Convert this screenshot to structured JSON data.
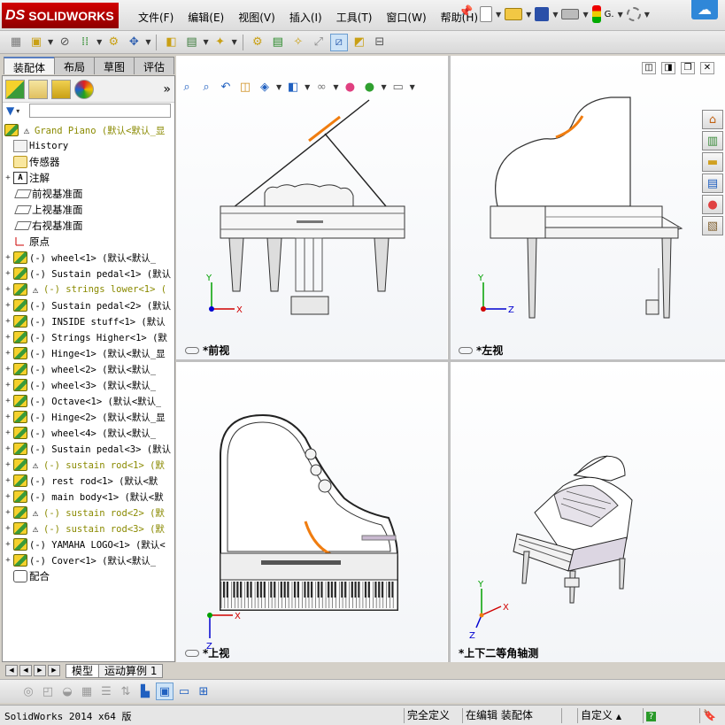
{
  "app": {
    "logo_ds": "DS",
    "logo_text": "SOLIDWORKS",
    "menu": [
      "文件(F)",
      "编辑(E)",
      "视图(V)",
      "插入(I)",
      "工具(T)",
      "窗口(W)",
      "帮助(H)"
    ],
    "menu_overflow": "G."
  },
  "left_tabs": [
    "装配体",
    "布局",
    "草图",
    "评估"
  ],
  "active_left_tab": "装配体",
  "tree": {
    "root": "Grand Piano  (默认<默认_显",
    "items": [
      {
        "label": "History",
        "icon": "history-icon",
        "expand": ""
      },
      {
        "label": "传感器",
        "icon": "sensor-icon",
        "expand": ""
      },
      {
        "label": "注解",
        "icon": "annotation-icon",
        "expand": "+"
      },
      {
        "label": "前视基准面",
        "icon": "plane-icon",
        "expand": ""
      },
      {
        "label": "上视基准面",
        "icon": "plane-icon",
        "expand": ""
      },
      {
        "label": "右视基准面",
        "icon": "plane-icon",
        "expand": ""
      },
      {
        "label": "原点",
        "icon": "origin-icon",
        "expand": ""
      },
      {
        "label": "(-) wheel<1> (默认<默认_",
        "icon": "part-icon",
        "expand": "+",
        "warning": false
      },
      {
        "label": "(-) Sustain pedal<1> (默认",
        "icon": "part-icon",
        "expand": "+",
        "warning": false
      },
      {
        "label": "(-) strings lower<1> (",
        "icon": "part-icon",
        "expand": "+",
        "warning": true
      },
      {
        "label": "(-) Sustain pedal<2> (默认",
        "icon": "part-icon",
        "expand": "+",
        "warning": false
      },
      {
        "label": "(-) INSIDE stuff<1> (默认",
        "icon": "part-icon",
        "expand": "+",
        "warning": false
      },
      {
        "label": "(-) Strings Higher<1> (默",
        "icon": "part-icon",
        "expand": "+",
        "warning": false
      },
      {
        "label": "(-) Hinge<1> (默认<默认_显",
        "icon": "part-icon",
        "expand": "+",
        "warning": false
      },
      {
        "label": "(-) wheel<2> (默认<默认_",
        "icon": "part-icon",
        "expand": "+",
        "warning": false
      },
      {
        "label": "(-) wheel<3> (默认<默认_",
        "icon": "part-icon",
        "expand": "+",
        "warning": false
      },
      {
        "label": "(-) Octave<1> (默认<默认_",
        "icon": "part-icon",
        "expand": "+",
        "warning": false
      },
      {
        "label": "(-) Hinge<2> (默认<默认_显",
        "icon": "part-icon",
        "expand": "+",
        "warning": false
      },
      {
        "label": "(-) wheel<4> (默认<默认_",
        "icon": "part-icon",
        "expand": "+",
        "warning": false
      },
      {
        "label": "(-) Sustain pedal<3> (默认",
        "icon": "part-icon",
        "expand": "+",
        "warning": false
      },
      {
        "label": "(-) sustain rod<1> (默",
        "icon": "part-icon",
        "expand": "+",
        "warning": true
      },
      {
        "label": "(-) rest rod<1> (默认<默",
        "icon": "part-icon",
        "expand": "+",
        "warning": false
      },
      {
        "label": "(-) main body<1> (默认<默",
        "icon": "part-icon",
        "expand": "+",
        "warning": false
      },
      {
        "label": "(-) sustain rod<2> (默",
        "icon": "part-icon",
        "expand": "+",
        "warning": true
      },
      {
        "label": "(-) sustain rod<3> (默",
        "icon": "part-icon",
        "expand": "+",
        "warning": true
      },
      {
        "label": "(-) YAMAHA LOGO<1> (默认<",
        "icon": "part-icon",
        "expand": "+",
        "warning": false
      },
      {
        "label": "(-) Cover<1> (默认<默认_",
        "icon": "part-icon",
        "expand": "+",
        "warning": false
      },
      {
        "label": "配合",
        "icon": "mate-icon",
        "expand": ""
      }
    ]
  },
  "views": {
    "front": "*前视",
    "left": "*左视",
    "top": "*上视",
    "iso": "*上下二等角轴测"
  },
  "axes": {
    "x": "X",
    "y": "Y",
    "z": "Z"
  },
  "bottom_tabs": [
    "模型",
    "运动算例 1"
  ],
  "active_bottom_tab": "模型",
  "status": {
    "version": "SolidWorks 2014 x64 版",
    "definition": "完全定义",
    "editing": "在编辑 装配体",
    "units": "自定义",
    "help": "?"
  },
  "colors": {
    "accent_orange": "#f07d10",
    "ds_red": "#c00000",
    "axis_x": "#d00000",
    "axis_y": "#00a000",
    "axis_z": "#0000d0"
  }
}
